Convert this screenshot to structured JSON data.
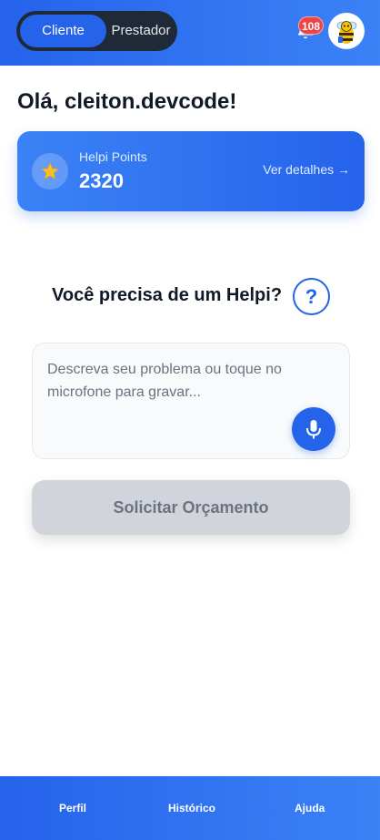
{
  "header": {
    "mode_toggle": {
      "options": [
        "Cliente",
        "Prestador"
      ],
      "selected": "Cliente"
    },
    "notifications": {
      "icon": "bell-icon",
      "count": "108"
    },
    "avatar": {
      "icon": "bee-mascot-icon"
    }
  },
  "greeting": "Olá, cleiton.devcode!",
  "points_card": {
    "icon": "star-icon",
    "label": "Helpi Points",
    "value": "2320",
    "details_link": "Ver detalhes →"
  },
  "request": {
    "question": "Você precisa de um Helpi?",
    "help_icon_label": "?",
    "input_placeholder": "Descreva seu problema ou toque no microfone para gravar...",
    "input_value": "",
    "mic_icon": "microphone-icon",
    "submit_label": "Solicitar Orçamento"
  },
  "bottom_nav": {
    "items": [
      {
        "label": "Perfil"
      },
      {
        "label": "Histórico"
      },
      {
        "label": "Ajuda"
      }
    ]
  },
  "colors": {
    "primary": "#2563eb",
    "primary_light": "#3b82f6",
    "toggle_bg": "#1f2937",
    "badge": "#ef4444",
    "disabled_button": "#d1d5db"
  }
}
